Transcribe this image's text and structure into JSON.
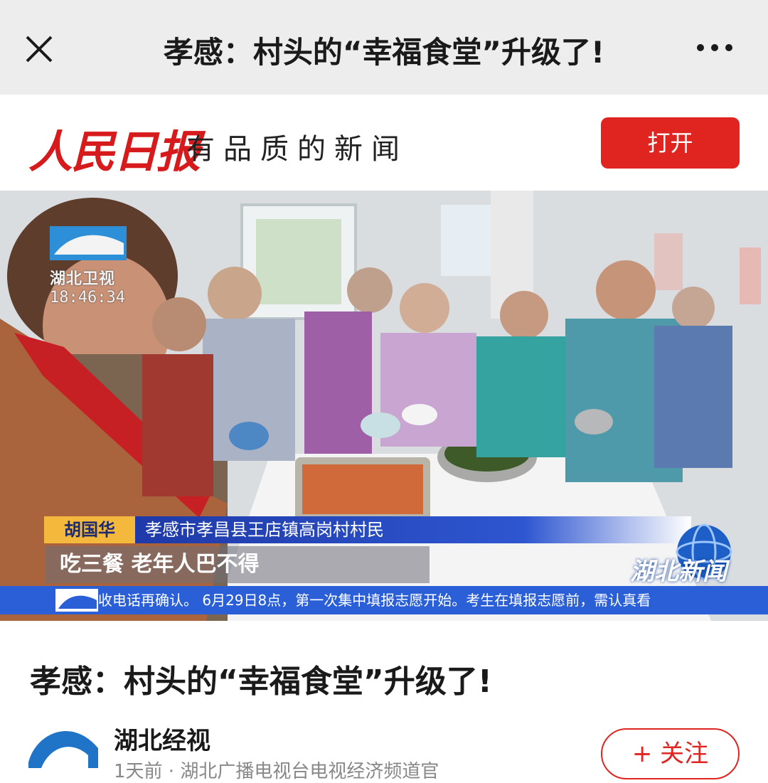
{
  "topbar": {
    "close_icon": "close-icon",
    "title": "孝感：村头的“幸福食堂”升级了!",
    "more_icon": "more-icon"
  },
  "brand": {
    "logo_text": "人民日报",
    "slogan": "有品质的新闻",
    "open_label": "打开",
    "accent": "#e02521"
  },
  "video": {
    "channel_name": "湖北卫视",
    "clock": "18:46:34",
    "person_name": "胡国华",
    "person_title": "孝感市孝昌县王店镇高岗村村民",
    "caption": "吃三餐 老年人巴不得",
    "program_logo": "湖北新闻",
    "ticker": "收电话再确认。          6月29日8点，第一次集中填报志愿开始。考生在填报志愿前，需认真看"
  },
  "article": {
    "headline": "孝感：村头的“幸福食堂”升级了!",
    "author_name": "湖北经视",
    "author_meta": "1天前 · 湖北广播电视台电视经济频道官",
    "follow_label": "+ 关注"
  }
}
